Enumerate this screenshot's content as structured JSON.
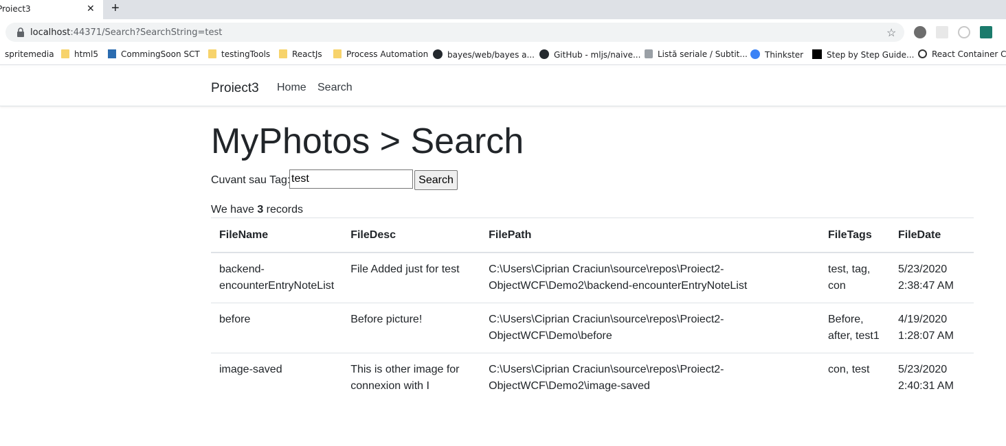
{
  "browser": {
    "tab_title": "Proiect3",
    "url_host": "localhost",
    "url_rest": ":44371/Search?SearchString=test",
    "bookmarks": [
      {
        "label": "spritemedia",
        "icon": "none"
      },
      {
        "label": "html5",
        "icon": "folder-icon"
      },
      {
        "label": "CommingSoon SCT",
        "icon": "drop-icon"
      },
      {
        "label": "testingTools",
        "icon": "folder-icon"
      },
      {
        "label": "ReactJs",
        "icon": "folder-icon"
      },
      {
        "label": "Process Automation",
        "icon": "folder-icon"
      },
      {
        "label": "bayes/web/bayes a...",
        "icon": "github-icon"
      },
      {
        "label": "GitHub - mljs/naive...",
        "icon": "github-icon"
      },
      {
        "label": "Listă seriale / Subtit...",
        "icon": "film-icon"
      },
      {
        "label": "Thinkster",
        "icon": "thinkster-icon"
      },
      {
        "label": "Step by Step Guide...",
        "icon": "medium-icon"
      },
      {
        "label": "React Container Co...",
        "icon": "react-icon"
      }
    ]
  },
  "navbar": {
    "brand": "Proiect3",
    "links": [
      "Home",
      "Search"
    ]
  },
  "page": {
    "title": "MyPhotos > Search",
    "search_label": "Cuvant sau Tag:",
    "search_value": "test",
    "search_button": "Search",
    "records_prefix": "We have",
    "records_count": "3",
    "records_suffix": "records"
  },
  "table": {
    "headers": [
      "FileName",
      "FileDesc",
      "FilePath",
      "FileTags",
      "FileDate"
    ],
    "rows": [
      {
        "name": [
          "backend-",
          "encounterEntryNoteList"
        ],
        "desc": [
          "File Added just for test"
        ],
        "path": [
          "C:\\Users\\Ciprian Craciun\\source\\repos\\Proiect2-",
          "ObjectWCF\\Demo2\\backend-encounterEntryNoteList"
        ],
        "tags": [
          "test, tag,",
          "con"
        ],
        "date": [
          "5/23/2020",
          "2:38:47 AM"
        ]
      },
      {
        "name": [
          "before"
        ],
        "desc": [
          "Before picture!"
        ],
        "path": [
          "C:\\Users\\Ciprian Craciun\\source\\repos\\Proiect2-",
          "ObjectWCF\\Demo\\before"
        ],
        "tags": [
          "Before,",
          "after, test1"
        ],
        "date": [
          "4/19/2020",
          "1:28:07 AM"
        ]
      },
      {
        "name": [
          "image-saved"
        ],
        "desc": [
          "This is other image for",
          "connexion with I"
        ],
        "path": [
          "C:\\Users\\Ciprian Craciun\\source\\repos\\Proiect2-",
          "ObjectWCF\\Demo2\\image-saved"
        ],
        "tags": [
          "con, test"
        ],
        "date": [
          "5/23/2020",
          "2:40:31 AM"
        ]
      }
    ]
  }
}
